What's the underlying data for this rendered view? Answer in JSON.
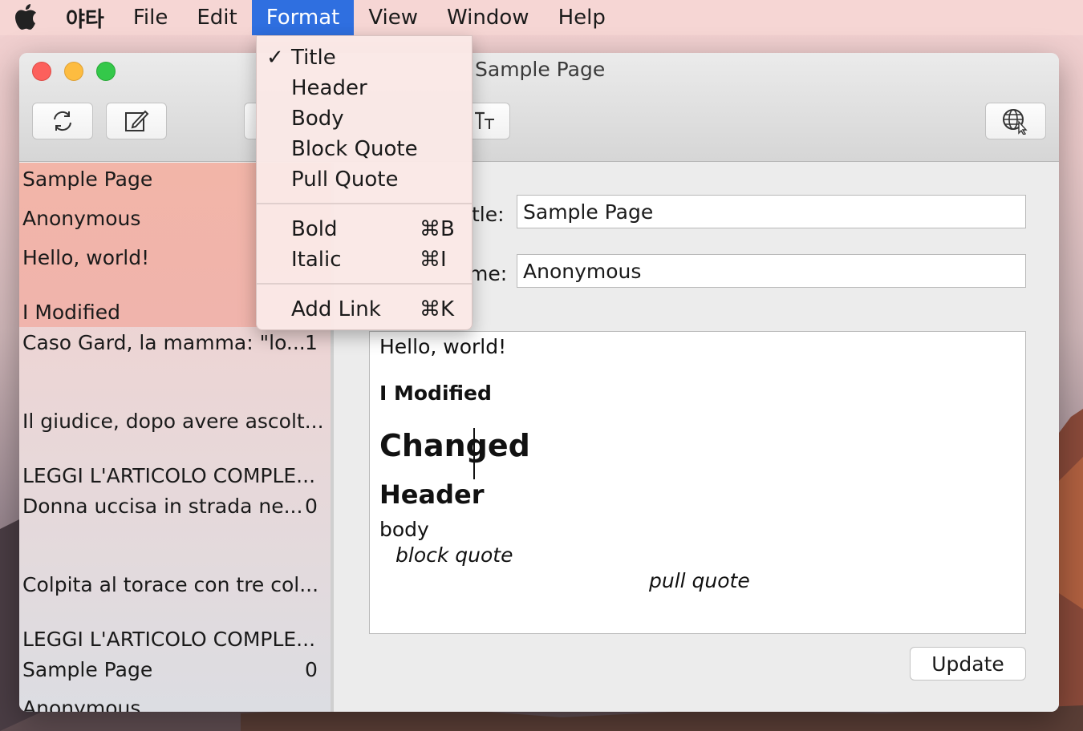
{
  "menubar": {
    "app_name": "야타",
    "items": [
      "File",
      "Edit",
      "Format",
      "View",
      "Window",
      "Help"
    ],
    "active": "Format"
  },
  "window": {
    "title": "Sample Page"
  },
  "format_menu": {
    "styles": [
      {
        "label": "Title",
        "checked": true
      },
      {
        "label": "Header",
        "checked": false
      },
      {
        "label": "Body",
        "checked": false
      },
      {
        "label": "Block Quote",
        "checked": false
      },
      {
        "label": "Pull Quote",
        "checked": false
      }
    ],
    "check_mark": "✓",
    "formatting": [
      {
        "label": "Bold",
        "shortcut": "⌘B"
      },
      {
        "label": "Italic",
        "shortcut": "⌘I"
      }
    ],
    "link": {
      "label": "Add Link",
      "shortcut": "⌘K"
    }
  },
  "sidebar": {
    "selected_item": {
      "title": "Sample Page",
      "author": "Anonymous",
      "preview1": "Hello, world!",
      "preview2": "I Modified"
    },
    "items": [
      {
        "text": "Caso Gard, la mamma: \"lo...",
        "count": "1"
      },
      {
        "text": "Il giudice, dopo avere ascolt...",
        "count": ""
      },
      {
        "text": "LEGGI L'ARTICOLO COMPLE...",
        "count": ""
      },
      {
        "text": "Donna uccisa in strada ne...",
        "count": "0"
      },
      {
        "text": "Colpita al torace con tre col...",
        "count": ""
      },
      {
        "text": "LEGGI L'ARTICOLO COMPLE...",
        "count": ""
      },
      {
        "text": "Sample Page",
        "count": "0"
      },
      {
        "text": "Anonymous",
        "count": ""
      }
    ]
  },
  "form": {
    "title_label": "tle:",
    "title_value": "Sample Page",
    "name_label": "me:",
    "name_value": "Anonymous"
  },
  "editor": {
    "line_body1": "Hello, world!",
    "line_bold": "I Modified",
    "line_title": "Changed",
    "line_header": "Header",
    "line_body2": "body",
    "line_block": "block quote",
    "line_pull": "pull quote"
  },
  "buttons": {
    "update": "Update"
  },
  "icons": [
    "apple-logo-icon",
    "refresh-icon",
    "compose-icon",
    "text-size-icon",
    "globe-cursor-icon"
  ]
}
